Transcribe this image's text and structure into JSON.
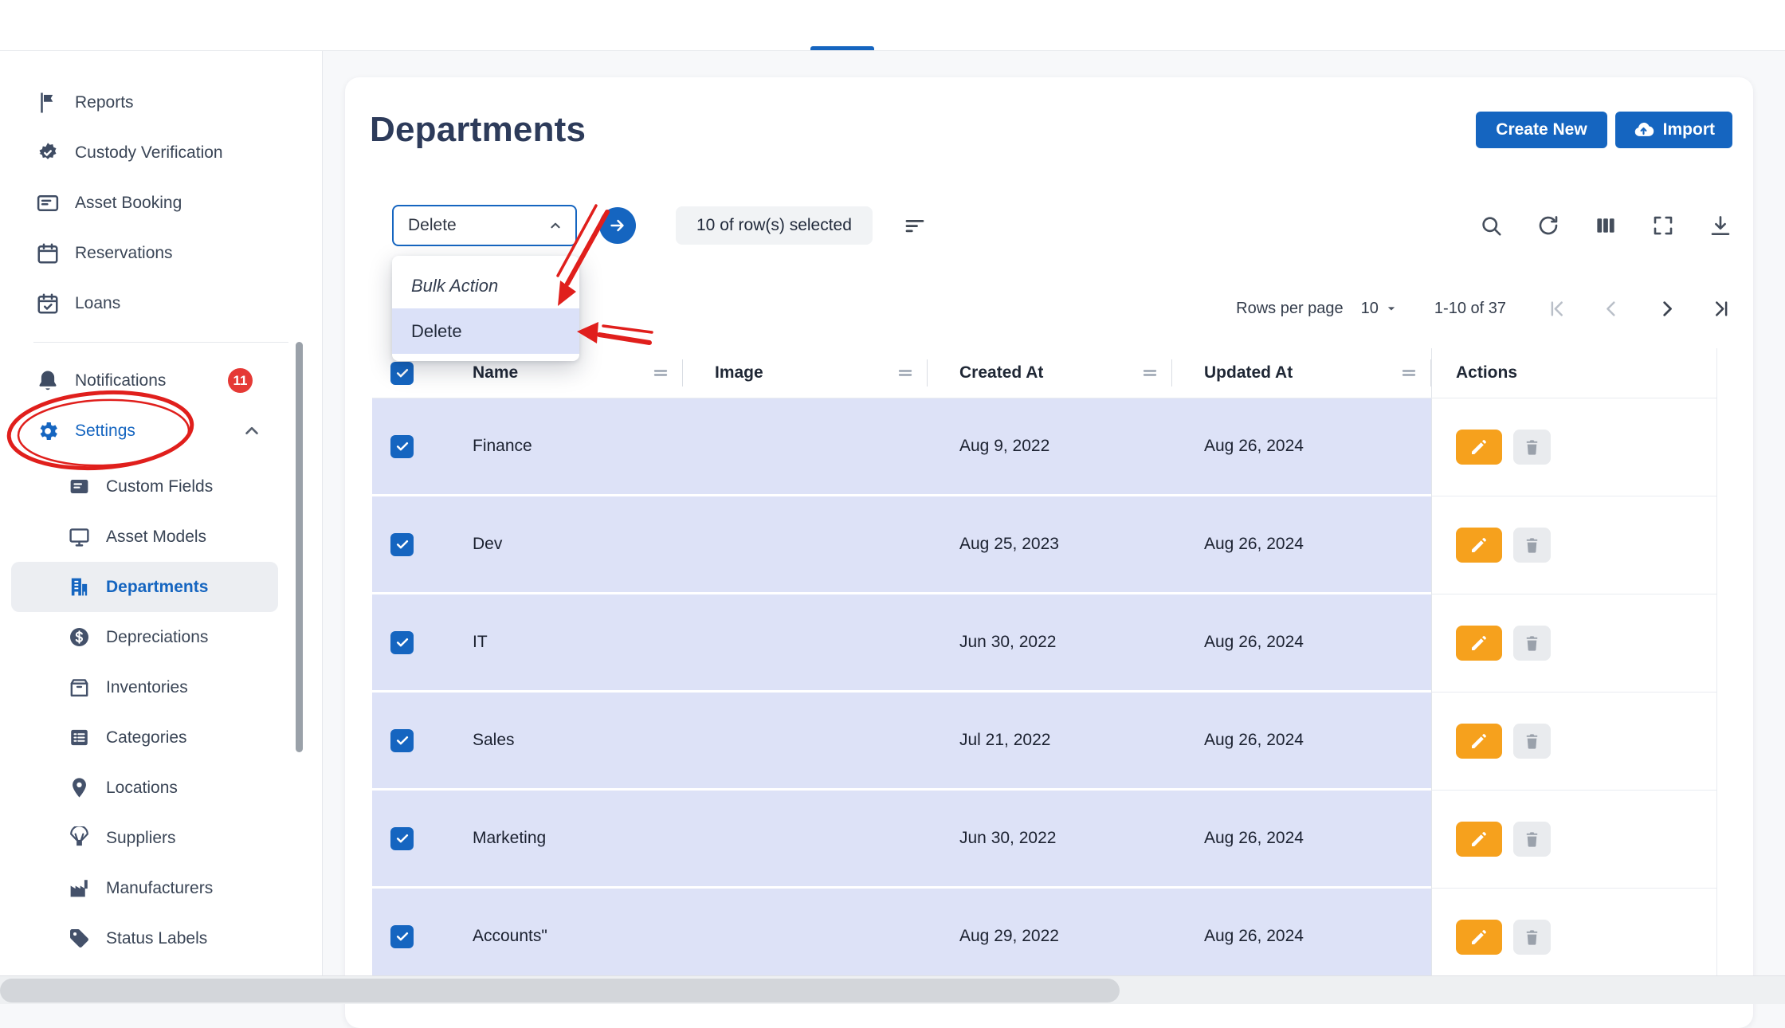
{
  "sidebar": {
    "items": [
      {
        "label": "Reports",
        "icon": "flag-icon"
      },
      {
        "label": "Custody Verification",
        "icon": "verified-icon"
      },
      {
        "label": "Asset Booking",
        "icon": "asset-booking-icon"
      },
      {
        "label": "Reservations",
        "icon": "calendar-icon"
      },
      {
        "label": "Loans",
        "icon": "loan-calendar-icon"
      }
    ],
    "notifications": {
      "label": "Notifications",
      "badge": "11",
      "icon": "bell-icon"
    },
    "settings": {
      "label": "Settings",
      "icon": "gear-icon",
      "expanded": true
    },
    "settings_children": [
      {
        "label": "Custom Fields",
        "icon": "custom-fields-icon"
      },
      {
        "label": "Asset Models",
        "icon": "asset-models-icon"
      },
      {
        "label": "Departments",
        "icon": "departments-icon",
        "active": true
      },
      {
        "label": "Depreciations",
        "icon": "depreciations-icon"
      },
      {
        "label": "Inventories",
        "icon": "inventories-icon"
      },
      {
        "label": "Categories",
        "icon": "categories-icon"
      },
      {
        "label": "Locations",
        "icon": "locations-icon"
      },
      {
        "label": "Suppliers",
        "icon": "suppliers-icon"
      },
      {
        "label": "Manufacturers",
        "icon": "manufacturers-icon"
      },
      {
        "label": "Status Labels",
        "icon": "status-labels-icon"
      }
    ]
  },
  "header": {
    "title": "Departments",
    "create_button": "Create New",
    "import_button": "Import"
  },
  "toolbar": {
    "select_value": "Delete",
    "selected_text": "10 of row(s) selected",
    "menu": [
      {
        "label": "Bulk Action",
        "type": "placeholder"
      },
      {
        "label": "Delete",
        "highlighted": true
      }
    ]
  },
  "pagination": {
    "rows_per_page_label": "Rows per page",
    "rows_per_page_value": "10",
    "range_text": "1-10 of 37"
  },
  "table": {
    "columns": [
      "Name",
      "Image",
      "Created At",
      "Updated At",
      "Actions"
    ],
    "rows": [
      {
        "name": "Finance",
        "image": "",
        "created_at": "Aug 9, 2022",
        "updated_at": "Aug 26, 2024",
        "selected": true
      },
      {
        "name": "Dev",
        "image": "",
        "created_at": "Aug 25, 2023",
        "updated_at": "Aug 26, 2024",
        "selected": true
      },
      {
        "name": "IT",
        "image": "",
        "created_at": "Jun 30, 2022",
        "updated_at": "Aug 26, 2024",
        "selected": true
      },
      {
        "name": "Sales",
        "image": "",
        "created_at": "Jul 21, 2022",
        "updated_at": "Aug 26, 2024",
        "selected": true
      },
      {
        "name": "Marketing",
        "image": "",
        "created_at": "Jun 30, 2022",
        "updated_at": "Aug 26, 2024",
        "selected": true
      },
      {
        "name": "Accounts\"",
        "image": "",
        "created_at": "Aug 29, 2022",
        "updated_at": "Aug 26, 2024",
        "selected": true
      }
    ]
  },
  "annotations": {
    "description": "hand-drawn red circle around Settings item and red arrows pointing to bulk-action dropdown Delete option",
    "color": "#e01f1c"
  },
  "colors": {
    "primary": "#1565c0",
    "selected_row": "#dde2f7",
    "edit_button": "#f6a11d",
    "notification_badge": "#e53935",
    "annotation": "#e01f1c"
  }
}
